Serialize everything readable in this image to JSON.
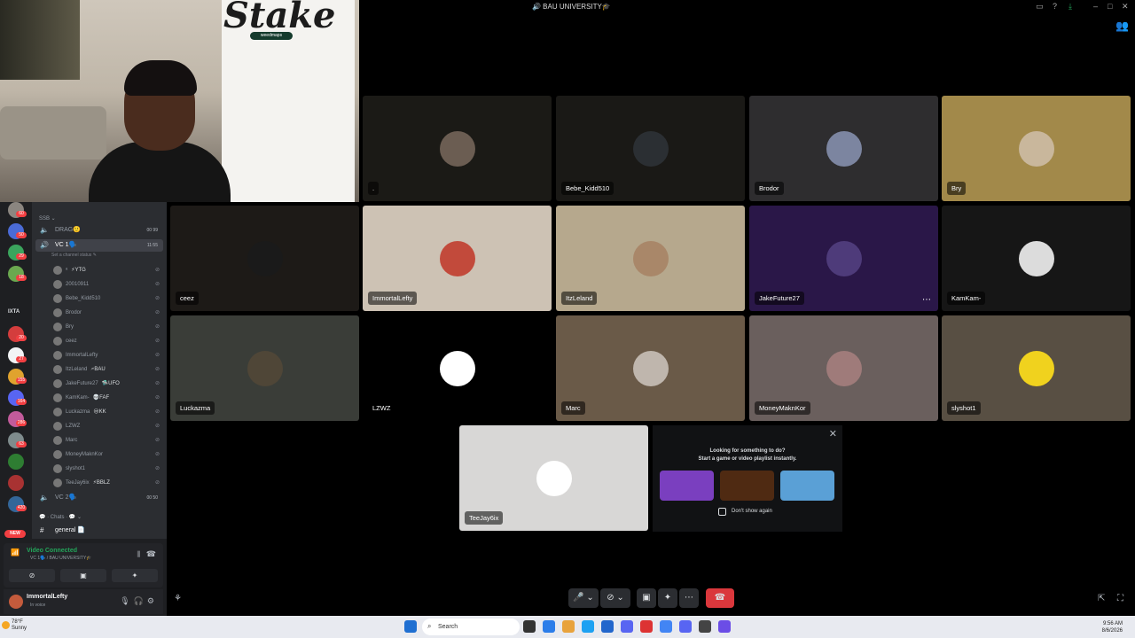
{
  "window": {
    "title": "🔊 BAU UNIVERSITY🎓"
  },
  "webcam": {
    "sign_text": "Stake",
    "tag_text": "weedmaps"
  },
  "servers": {
    "text_label": "IXTA",
    "badges": [
      "60",
      "50",
      "29",
      "18",
      "20",
      "27",
      "155",
      "164",
      "286",
      "63",
      "420"
    ]
  },
  "channels": {
    "category": "SSB ⌄",
    "rows": [
      {
        "name": "DRAG🙂",
        "count": "00 99"
      },
      {
        "name": "VC 1🗣️",
        "count": "11:55"
      },
      {
        "name": "VC 2🗣️",
        "count": "00 50"
      },
      {
        "name": "general 📄",
        "count": ""
      }
    ],
    "chats_category": "💬 · Chats · 💬 ⌄",
    "status_hint": "Set a channel status ✎"
  },
  "voice_users": [
    {
      "name": "ᵃ",
      "tag": "⚡YTG"
    },
    {
      "name": "20010911",
      "tag": ""
    },
    {
      "name": "Bebe_Kidd510",
      "tag": ""
    },
    {
      "name": "Brodor",
      "tag": ""
    },
    {
      "name": "Bry",
      "tag": ""
    },
    {
      "name": "ceez",
      "tag": ""
    },
    {
      "name": "ImmortalLefty",
      "tag": ""
    },
    {
      "name": "ItzLeland",
      "tag": "🗲BAU"
    },
    {
      "name": "JakeFuture27",
      "tag": "🛸UFO"
    },
    {
      "name": "KamKam-",
      "tag": "💀FAF"
    },
    {
      "name": "Luckazma",
      "tag": "😒KK"
    },
    {
      "name": "LZWZ",
      "tag": ""
    },
    {
      "name": "Marc",
      "tag": ""
    },
    {
      "name": "MoneyMaknKor",
      "tag": ""
    },
    {
      "name": "slyshot1",
      "tag": ""
    },
    {
      "name": "TeeJay6ix",
      "tag": "⚡BBLZ"
    }
  ],
  "new_badge": "NEW",
  "voice_panel": {
    "title": "Video Connected",
    "subtitle": "VC 1🗣️ / BAU UNIVERSITY🎓"
  },
  "user_panel": {
    "name": "ImmortalLefty",
    "status": "In voice"
  },
  "tiles": [
    {
      "label": ".",
      "bg": "#1b1a16",
      "avatar": "#6b5d52"
    },
    {
      "label": "Bebe_Kidd510",
      "bg": "#1a1916",
      "avatar": "#2b2f33"
    },
    {
      "label": "Brodor",
      "bg": "#2e2d2f",
      "avatar": "#7c85a0"
    },
    {
      "label": "Bry",
      "bg": "#a2894a",
      "avatar": "#c9b79c"
    },
    {
      "label": "ceez",
      "bg": "#1d1a17",
      "avatar": "#1a1a1a"
    },
    {
      "label": "ImmortalLefty",
      "bg": "#cdc2b4",
      "avatar": "#c24a3b"
    },
    {
      "label": "ItzLeland",
      "bg": "#b6a88d",
      "avatar": "#a98769"
    },
    {
      "label": "JakeFuture27",
      "bg": "#2a1748",
      "avatar": "#4e3b7a"
    },
    {
      "label": "KamKam-",
      "bg": "#161616",
      "avatar": "#dcdcdc"
    },
    {
      "label": "Luckazma",
      "bg": "#3a3d38",
      "avatar": "#4f4637"
    },
    {
      "label": "LZWZ",
      "bg": "#000000",
      "avatar": "#ffffff"
    },
    {
      "label": "Marc",
      "bg": "#6a5a48",
      "avatar": "#bfb6ad"
    },
    {
      "label": "MoneyMaknKor",
      "bg": "#6a5f5d",
      "avatar": "#9f7b7a"
    },
    {
      "label": "slyshot1",
      "bg": "#584f43",
      "avatar": "#f0d21e"
    },
    {
      "label": "TeeJay6ix",
      "bg": "#d8d7d6",
      "avatar": "#ffffff"
    }
  ],
  "activity": {
    "line1": "Looking for something to do?",
    "line2": "Start a game or video playlist instantly.",
    "checkbox": "Don't show again",
    "thumb_colors": [
      "#7a3fbf",
      "#4f2a12",
      "#5aa0d6"
    ]
  },
  "taskbar": {
    "temp": "78°F",
    "cond": "Sunny",
    "search": "Search",
    "time": "9:56 AM",
    "date": "8/6/2026"
  }
}
